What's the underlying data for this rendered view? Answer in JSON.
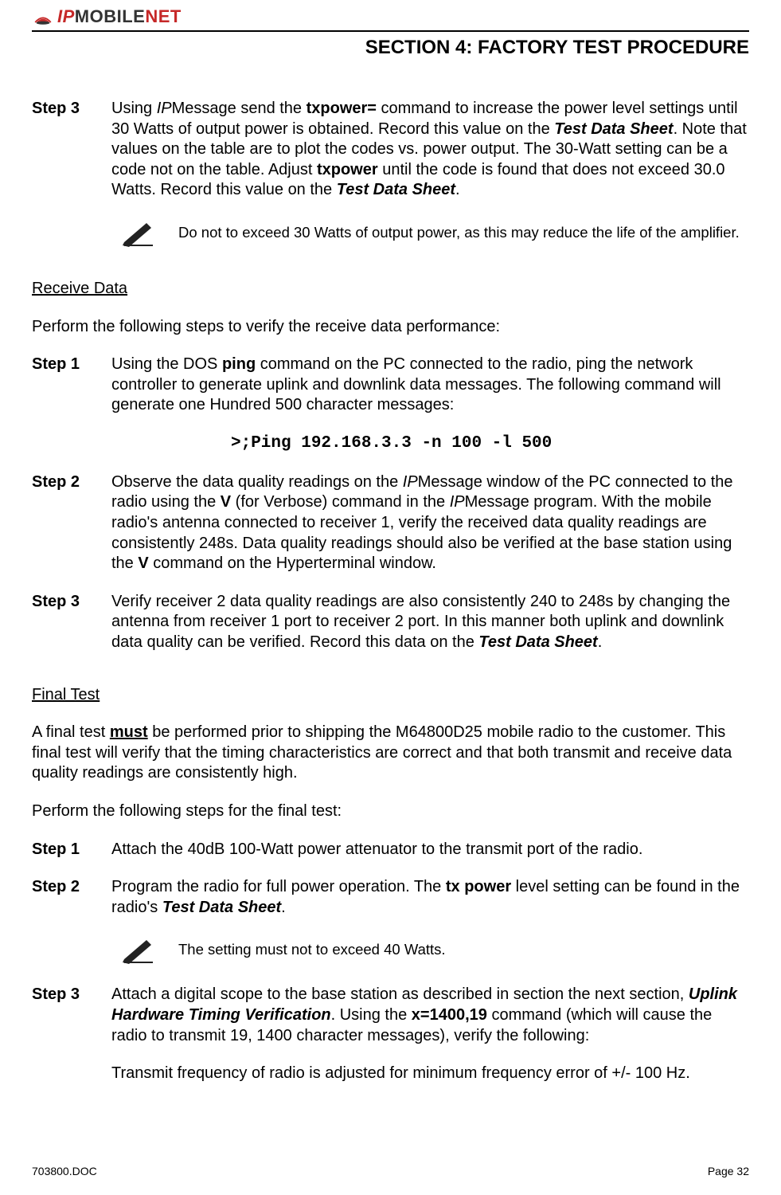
{
  "header": {
    "logo_ip": "IP",
    "logo_mobile": "MOBILE",
    "logo_net": "NET",
    "section_title": "SECTION 4: FACTORY TEST PROCEDURE"
  },
  "content": {
    "top_step3_label": "Step 3",
    "top_step3_t1": "Using ",
    "top_step3_ip": "IP",
    "top_step3_t2": "Message send the ",
    "top_step3_cmd": "txpower=",
    "top_step3_t3": " command to increase the power level settings until 30 Watts of output power is obtained.  Record this value on the ",
    "top_step3_tds1": "Test Data Sheet",
    "top_step3_t4": ".  Note that values on the table are to plot the codes vs. power output.  The 30-Watt setting can be a code not on the table. Adjust ",
    "top_step3_cmd2": "txpower",
    "top_step3_t5": " until the code is found that does not exceed 30.0 Watts.  Record this value on the ",
    "top_step3_tds2": "Test Data Sheet",
    "top_step3_t6": ".",
    "note1": "Do not to exceed 30 Watts of output power, as this may reduce the life of the amplifier.",
    "receive_head": "Receive Data",
    "receive_intro": "Perform the following steps to verify the receive data performance:",
    "rd_step1_label": "Step 1",
    "rd_step1_t1": "Using the DOS ",
    "rd_step1_ping": "ping",
    "rd_step1_t2": " command on the PC connected to the radio, ping the network controller to generate uplink and downlink data messages.  The following command will generate one Hundred 500 character messages:",
    "rd_ping_cmd": ">;Ping 192.168.3.3 -n 100 -l 500",
    "rd_step2_label": "Step 2",
    "rd_step2_t1": "Observe the data quality readings on the ",
    "rd_step2_ip1": "IP",
    "rd_step2_t2": "Message window of the PC connected to the radio using the ",
    "rd_step2_v1": "V",
    "rd_step2_t3": " (for Verbose) command in the ",
    "rd_step2_ip2": "IP",
    "rd_step2_t4": "Message program.  With the mobile radio's antenna connected to receiver 1, verify the received data quality readings are consistently 248s.  Data quality readings should also be verified at the base station using the ",
    "rd_step2_v2": "V",
    "rd_step2_t5": " command on the Hyperterminal window.",
    "rd_step3_label": "Step 3",
    "rd_step3_t1": "Verify receiver 2 data quality readings are also consistently 240 to 248s by changing the antenna from receiver 1 port to receiver 2 port.  In this manner both uplink and downlink data quality can be verified.  Record this data on the ",
    "rd_step3_tds": "Test Data Sheet",
    "rd_step3_t2": ".",
    "final_head": "Final Test",
    "final_p1_t1": "A final test ",
    "final_p1_must": "must",
    "final_p1_t2": " be performed prior to shipping the M64800D25 mobile radio to the customer.  This final test will verify that the timing characteristics are correct and that both transmit and receive data quality readings are consistently high.",
    "final_intro": "Perform the following steps for the final test:",
    "ft_step1_label": "Step 1",
    "ft_step1_text": "Attach the 40dB 100-Watt power attenuator to the transmit port of the radio.",
    "ft_step2_label": "Step 2",
    "ft_step2_t1": "Program the radio for full power operation.  The ",
    "ft_step2_txp": "tx power",
    "ft_step2_t2": " level setting can be found in the radio's ",
    "ft_step2_tds": "Test Data Sheet",
    "ft_step2_t3": ".",
    "note2": "The setting must not to exceed 40 Watts.",
    "ft_step3_label": "Step 3",
    "ft_step3_t1": "Attach a digital scope to the base station as described in section the next section, ",
    "ft_step3_uhtv": "Uplink Hardware Timing Verification",
    "ft_step3_t2": ".  Using the ",
    "ft_step3_x": "x=1400,19",
    "ft_step3_t3": " command (which will cause the radio to transmit 19, 1400 character messages), verify the following:",
    "ft_step3_sub": "Transmit frequency of radio is adjusted for minimum frequency error of +/- 100 Hz."
  },
  "footer": {
    "left": "703800.DOC",
    "right": "Page 32"
  }
}
